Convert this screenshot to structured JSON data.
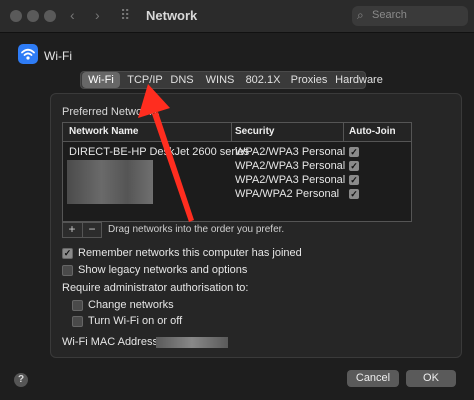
{
  "titlebar": {
    "title": "Network",
    "search_placeholder": "Search",
    "back_glyph": "‹",
    "forward_glyph": "›",
    "grid_glyph": "⠿",
    "search_glyph": "⌕"
  },
  "header": {
    "wifi_label": "Wi-Fi"
  },
  "tabs": [
    {
      "label": "Wi-Fi",
      "selected": true
    },
    {
      "label": "TCP/IP",
      "selected": false
    },
    {
      "label": "DNS",
      "selected": false
    },
    {
      "label": "WINS",
      "selected": false
    },
    {
      "label": "802.1X",
      "selected": false
    },
    {
      "label": "Proxies",
      "selected": false
    },
    {
      "label": "Hardware",
      "selected": false
    }
  ],
  "preferred": {
    "label": "Preferred Networks:",
    "columns": {
      "name": "Network Name",
      "security": "Security",
      "autojoin": "Auto-Join"
    },
    "rows": [
      {
        "name": "DIRECT-BE-HP DeskJet 2600 series",
        "security": "WPA2/WPA3 Personal",
        "autojoin": true
      },
      {
        "name": "",
        "security": "WPA2/WPA3 Personal",
        "autojoin": true
      },
      {
        "name": "",
        "security": "WPA2/WPA3 Personal",
        "autojoin": true
      },
      {
        "name": "",
        "security": "WPA/WPA2 Personal",
        "autojoin": true
      }
    ],
    "add_glyph": "+",
    "remove_glyph": "−",
    "drag_hint": "Drag networks into the order you prefer."
  },
  "options": {
    "remember": {
      "label": "Remember networks this computer has joined",
      "checked": true
    },
    "legacy": {
      "label": "Show legacy networks and options",
      "checked": false
    },
    "require_label": "Require administrator authorisation to:",
    "change_networks": {
      "label": "Change networks",
      "checked": false
    },
    "turn_wifi": {
      "label": "Turn Wi-Fi on or off",
      "checked": false
    }
  },
  "mac": {
    "label": "Wi-Fi MAC Address:"
  },
  "footer": {
    "help": "?",
    "cancel": "Cancel",
    "ok": "OK"
  },
  "colors": {
    "arrow": "#ff2d1f",
    "accent": "#2e7cf6"
  },
  "check_glyph": "✓"
}
